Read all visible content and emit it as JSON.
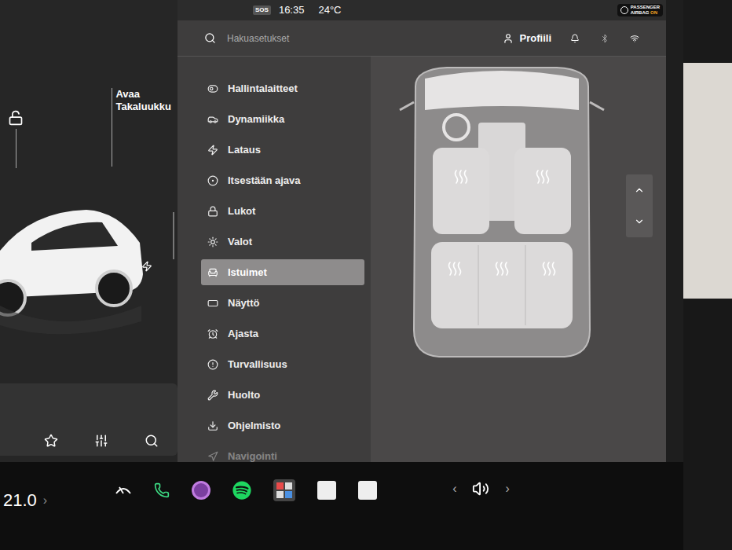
{
  "status_bar": {
    "sos": "SOS",
    "time": "16:35",
    "temperature": "24°C",
    "airbag": {
      "label": "PASSENGER",
      "line2": "AIRBAG",
      "state": "ON"
    }
  },
  "car_panel": {
    "trunk_button": [
      "Avaa",
      "Takaluukku"
    ]
  },
  "search": {
    "placeholder": "Hakuasetukset"
  },
  "profile": {
    "label": "Profiili"
  },
  "sidebar": {
    "items": [
      {
        "label": "Hallintalaitteet",
        "selected": false,
        "dimmed": false
      },
      {
        "label": "Dynamiikka",
        "selected": false,
        "dimmed": false
      },
      {
        "label": "Lataus",
        "selected": false,
        "dimmed": false
      },
      {
        "label": "Itsestään ajava",
        "selected": false,
        "dimmed": false
      },
      {
        "label": "Lukot",
        "selected": false,
        "dimmed": false
      },
      {
        "label": "Valot",
        "selected": false,
        "dimmed": false
      },
      {
        "label": "Istuimet",
        "selected": true,
        "dimmed": false
      },
      {
        "label": "Näyttö",
        "selected": false,
        "dimmed": false
      },
      {
        "label": "Ajasta",
        "selected": false,
        "dimmed": false
      },
      {
        "label": "Turvallisuus",
        "selected": false,
        "dimmed": false
      },
      {
        "label": "Huolto",
        "selected": false,
        "dimmed": false
      },
      {
        "label": "Ohjelmisto",
        "selected": false,
        "dimmed": false
      },
      {
        "label": "Navigointi",
        "selected": false,
        "dimmed": true
      }
    ]
  },
  "bottom_bar": {
    "cabin_temperature": "21.0",
    "temp_arrow": "›",
    "volume_prev": "‹",
    "volume_next": "›"
  }
}
